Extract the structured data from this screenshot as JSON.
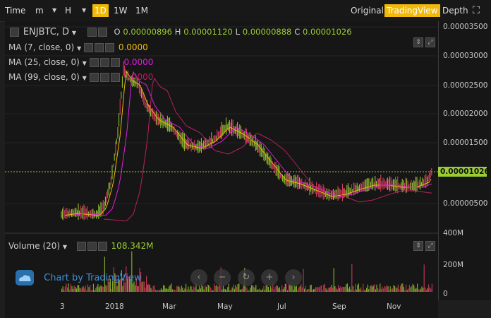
{
  "toolbar": {
    "time_label": "Time",
    "minute_label": "m",
    "hour_label": "H",
    "intervals": [
      "1D",
      "1W",
      "1M"
    ],
    "active_interval": "1D",
    "views": [
      "Original",
      "TradingView",
      "Depth"
    ],
    "active_view": "TradingView"
  },
  "legend": {
    "symbol": "ENJBTC, D",
    "ohlc": {
      "o_label": "O",
      "o": "0.00000896",
      "h_label": "H",
      "h": "0.00001120",
      "l_label": "L",
      "l": "0.00000888",
      "c_label": "C",
      "c": "0.00001026"
    },
    "ma": [
      {
        "label": "MA (7, close, 0)",
        "value": "0.0000",
        "color": "#f0b90b"
      },
      {
        "label": "MA (25, close, 0)",
        "value": "0.0000",
        "color": "#e020e0"
      },
      {
        "label": "MA (99, close, 0)",
        "value": "0.0000",
        "color": "#b8215e"
      }
    ],
    "volume_label": "Volume (20)",
    "volume_value": "108.342M"
  },
  "price_axis": {
    "ticks": [
      "0.00003500",
      "0.00003000",
      "0.00002500",
      "0.00002000",
      "0.00001500",
      "0.00000500"
    ],
    "current_price": "0.00001026",
    "current_color": "#9acd32"
  },
  "volume_axis": {
    "ticks": [
      "400M",
      "200M",
      "0"
    ]
  },
  "time_axis": {
    "ticks": [
      "3",
      "2018",
      "Mar",
      "May",
      "Jul",
      "Sep",
      "Nov"
    ]
  },
  "watermark": "Chart by TradingView",
  "colors": {
    "up": "#9acd32",
    "down": "#e04060",
    "background": "#161616",
    "accent": "#f0b90b"
  }
}
